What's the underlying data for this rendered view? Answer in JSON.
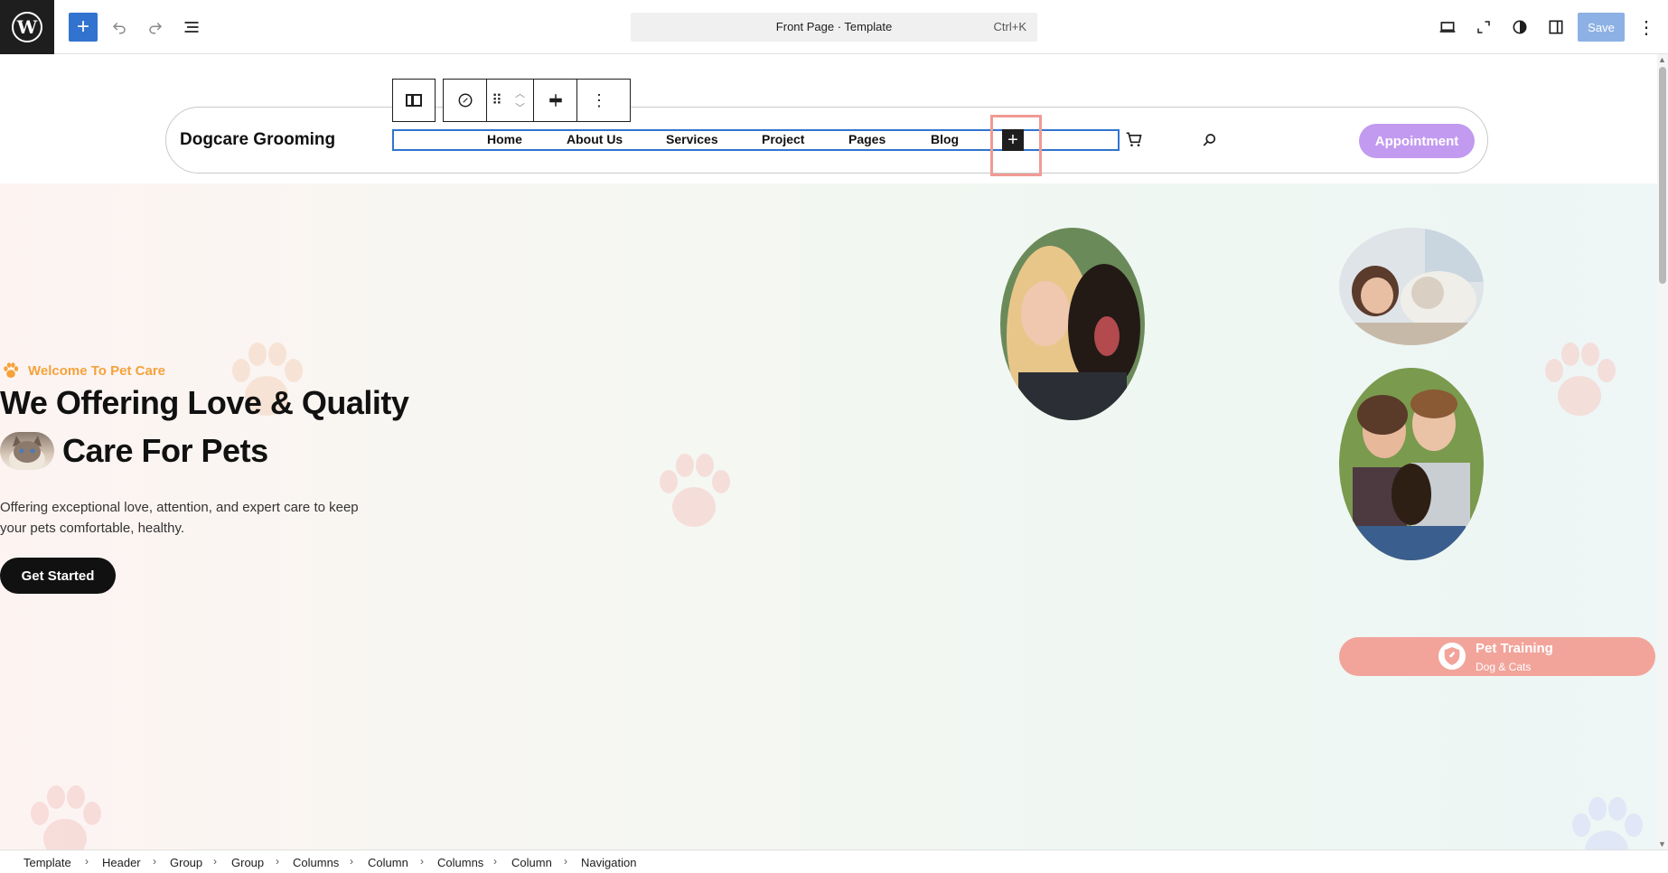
{
  "topbar": {
    "command_title": "Front Page · Template",
    "command_shortcut": "Ctrl+K",
    "save_label": "Save",
    "accent": "#3173cf"
  },
  "site": {
    "title": "Dogcare Grooming",
    "nav": [
      "Home",
      "About Us",
      "Services",
      "Project",
      "Pages",
      "Blog"
    ],
    "appointment_label": "Appointment",
    "appointment_color": "#c29af0"
  },
  "hero": {
    "kicker": "Welcome To Pet Care",
    "heading_line1": "We Offering Love & Quality",
    "heading_line2": "Care For Pets",
    "description_line1": "Offering exceptional love, attention, and expert care to keep",
    "description_line2": "your pets comfortable, healthy.",
    "cta_label": "Get Started",
    "badge_title": "Pet Training",
    "badge_subtitle": "Dog & Cats",
    "badge_color": "#f2a49b",
    "kicker_color": "#f5a23a"
  },
  "breadcrumb": [
    "Template",
    "Header",
    "Group",
    "Group",
    "Columns",
    "Column",
    "Columns",
    "Column",
    "Navigation"
  ],
  "icons": {
    "logo": "wordpress-icon",
    "add": "plus-icon",
    "undo": "undo-icon",
    "redo": "redo-icon",
    "list_view": "list-view-icon",
    "view": "desktop-view-icon",
    "fullscreen": "fullscreen-icon",
    "styles": "styles-contrast-icon",
    "sidebar": "sidebar-icon",
    "more": "more-vertical-icon",
    "cart": "cart-icon",
    "search": "search-icon"
  }
}
